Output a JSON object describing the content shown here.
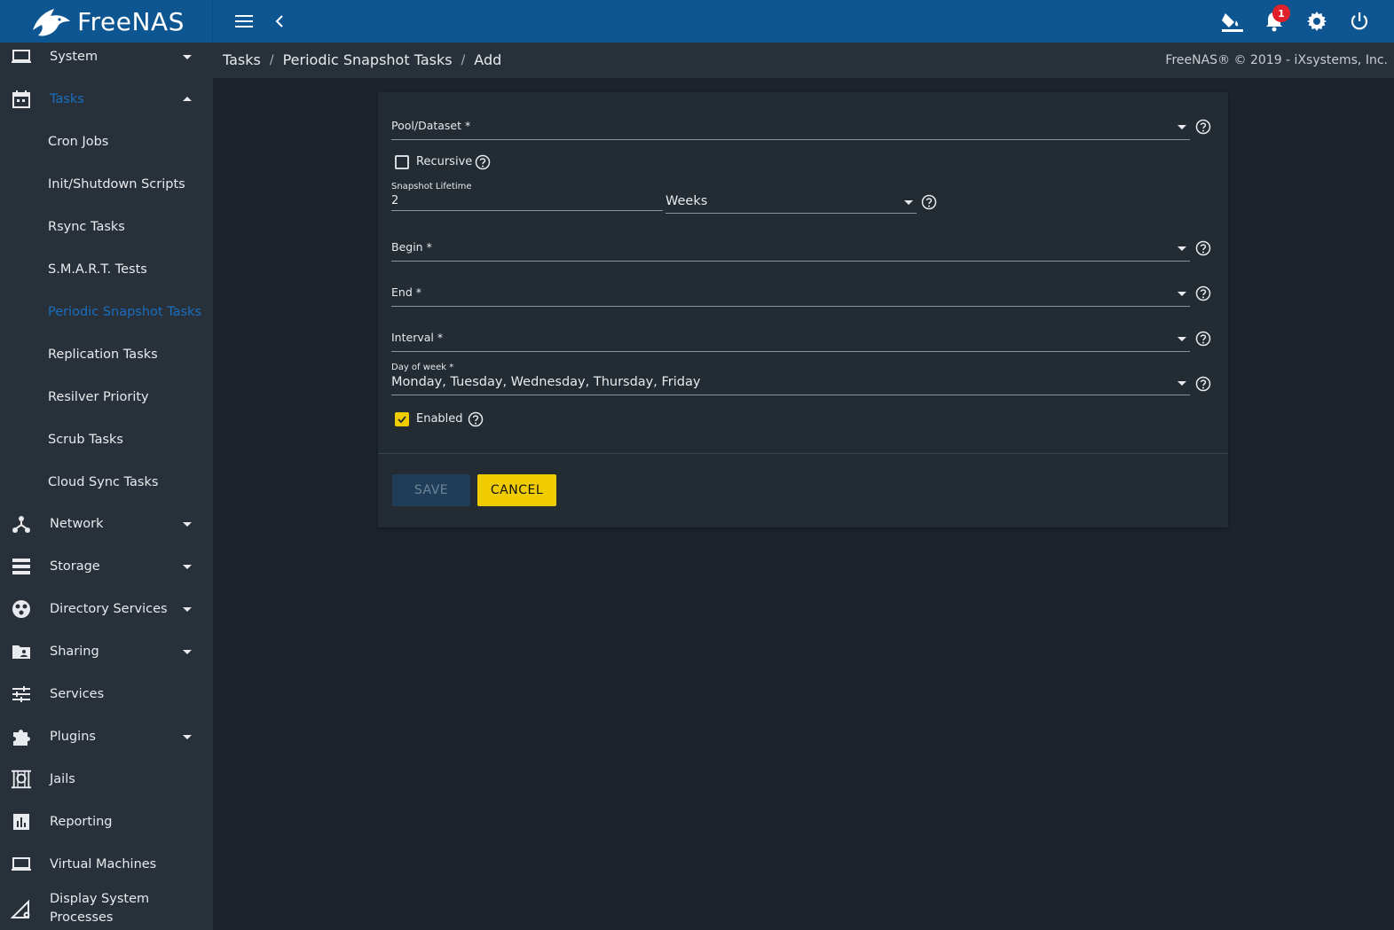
{
  "app": {
    "brand": "FreeNAS"
  },
  "topbar": {
    "notifications_count": "1"
  },
  "sidebar": {
    "items": [
      {
        "label": "System",
        "icon": "laptop-icon",
        "expanded": false
      },
      {
        "label": "Tasks",
        "icon": "calendar-icon",
        "expanded": true
      },
      {
        "label": "Network",
        "icon": "network-icon",
        "expanded": false
      },
      {
        "label": "Storage",
        "icon": "storage-icon",
        "expanded": false
      },
      {
        "label": "Directory Services",
        "icon": "directory-services-icon",
        "expanded": false
      },
      {
        "label": "Sharing",
        "icon": "sharing-folder-icon",
        "expanded": false
      },
      {
        "label": "Services",
        "icon": "tune-icon"
      },
      {
        "label": "Plugins",
        "icon": "puzzle-icon",
        "expanded": false
      },
      {
        "label": "Jails",
        "icon": "jail-icon"
      },
      {
        "label": "Reporting",
        "icon": "bar-chart-icon"
      },
      {
        "label": "Virtual Machines",
        "icon": "computer-icon"
      },
      {
        "label": "Display System Processes",
        "label_line1": "Display System",
        "label_line2": "Processes",
        "icon": "system-processes-icon"
      }
    ],
    "tasks_children": [
      "Cron Jobs",
      "Init/Shutdown Scripts",
      "Rsync Tasks",
      "S.M.A.R.T. Tests",
      "Periodic Snapshot Tasks",
      "Replication Tasks",
      "Resilver Priority",
      "Scrub Tasks",
      "Cloud Sync Tasks"
    ]
  },
  "breadcrumb": [
    "Tasks",
    "Periodic Snapshot Tasks",
    "Add"
  ],
  "copyright": "FreeNAS® © 2019 - iXsystems, Inc.",
  "form": {
    "pool_dataset": {
      "label": "Pool/Dataset *",
      "value": ""
    },
    "recursive": {
      "label": "Recursive",
      "checked": false
    },
    "snapshot_lifetime": {
      "label": "Snapshot Lifetime",
      "value": "2",
      "unit": "Weeks"
    },
    "begin": {
      "label": "Begin *",
      "value": ""
    },
    "end": {
      "label": "End *",
      "value": ""
    },
    "interval": {
      "label": "Interval *",
      "value": ""
    },
    "day_of_week": {
      "label": "Day of week *",
      "value": "Monday, Tuesday, Wednesday, Thursday, Friday"
    },
    "enabled": {
      "label": "Enabled",
      "checked": true
    },
    "save_label": "SAVE",
    "cancel_label": "CANCEL"
  },
  "colors": {
    "topbar": "#0e5692",
    "sidebar": "#283139",
    "accent": "#f0cb00",
    "active_link": "#1a6dbf"
  }
}
